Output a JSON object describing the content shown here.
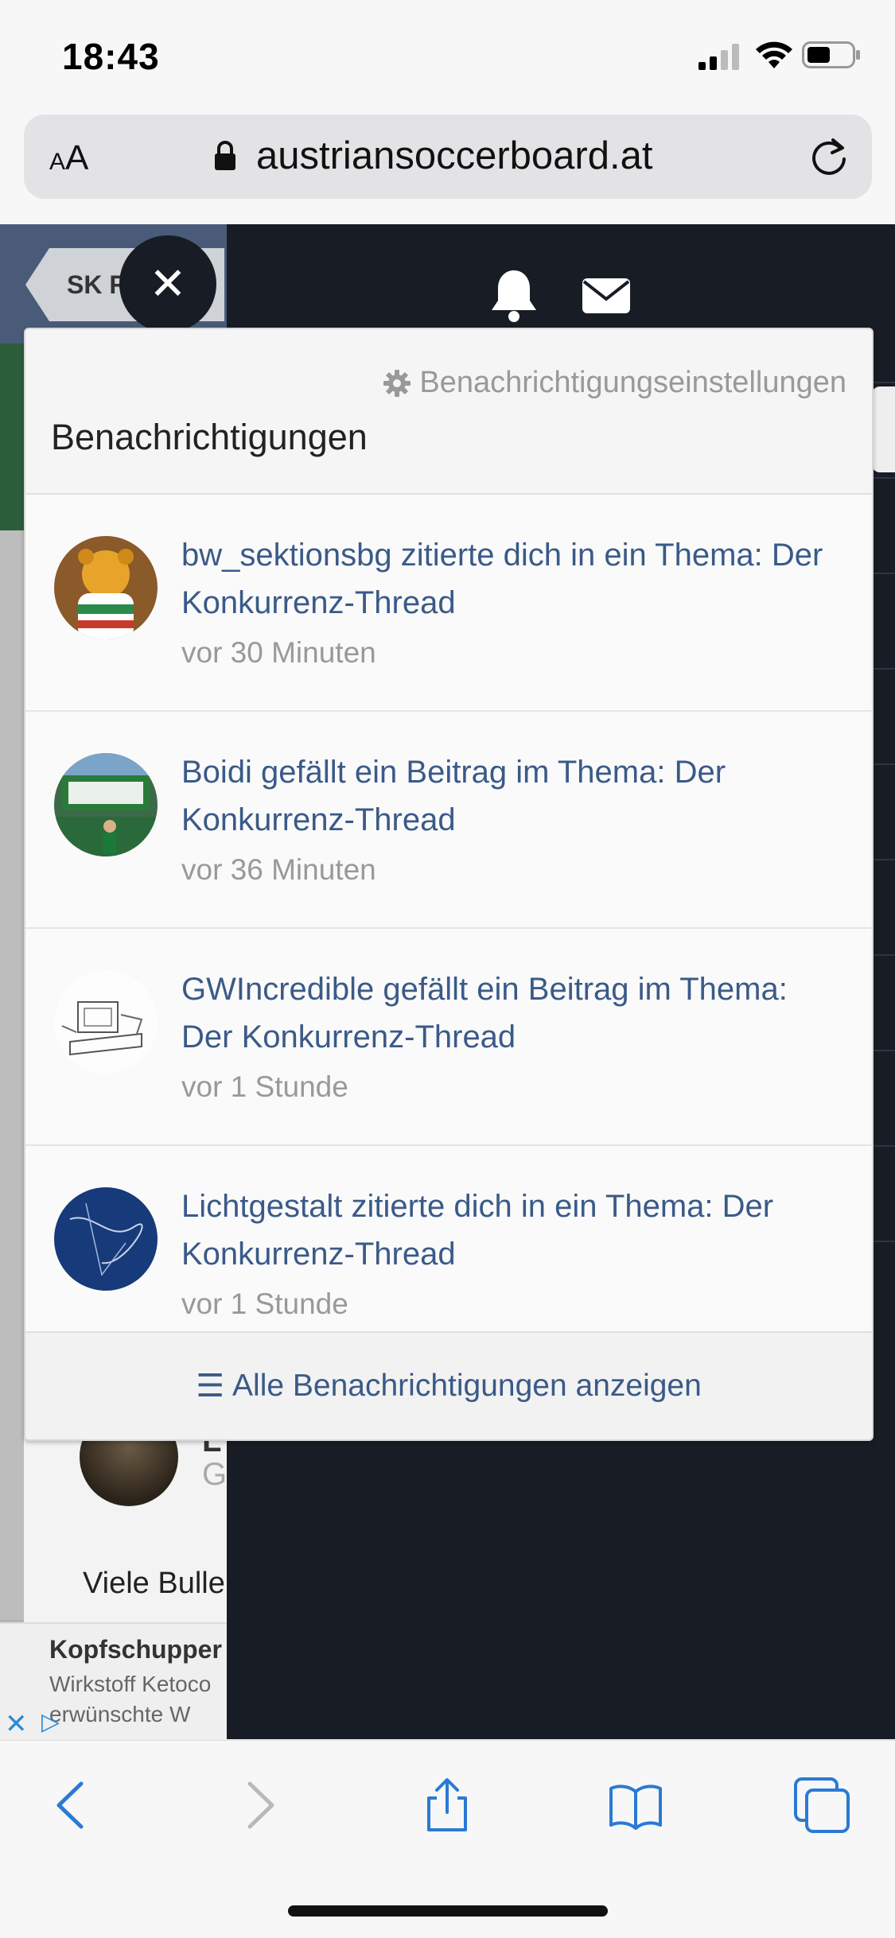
{
  "status_bar": {
    "time": "18:43"
  },
  "browser": {
    "text_size_label": "AA",
    "url": "austriansoccerboard.at"
  },
  "page": {
    "breadcrumb": "SK R",
    "partial_name": "L",
    "partial_group": "G",
    "partial_post": "Viele Bulle"
  },
  "ad": {
    "title": "Kopfschupper",
    "line1": "Wirkstoff Ketoco",
    "line2": "erwünschte W"
  },
  "notifications_panel": {
    "settings_link": "Benachrichtigungseinstellungen",
    "title": "Benachrichtigungen",
    "items": [
      {
        "text": "bw_sektionsbg zitierte dich in ein Thema: Der Konkurrenz-Thread",
        "time": "vor 30 Minuten"
      },
      {
        "text": "Boidi gefällt ein Beitrag im Thema: Der Konkurrenz-Thread",
        "time": "vor 36 Minuten"
      },
      {
        "text": "GWIncredible gefällt ein Beitrag im Thema: Der Konkurrenz-Thread",
        "time": "vor 1 Stunde"
      },
      {
        "text": "Lichtgestalt zitierte dich in ein Thema: Der Konkurrenz-Thread",
        "time": "vor 1 Stunde"
      }
    ],
    "footer_link": "Alle Benachrichtigungen anzeigen"
  },
  "colors": {
    "link": "#3a5a88",
    "dark_bg": "#181c24",
    "toolbar_accent": "#2a7ad4"
  },
  "toolbar": {
    "icons": [
      "back-icon",
      "forward-icon",
      "share-icon",
      "bookmarks-icon",
      "tabs-icon"
    ]
  }
}
